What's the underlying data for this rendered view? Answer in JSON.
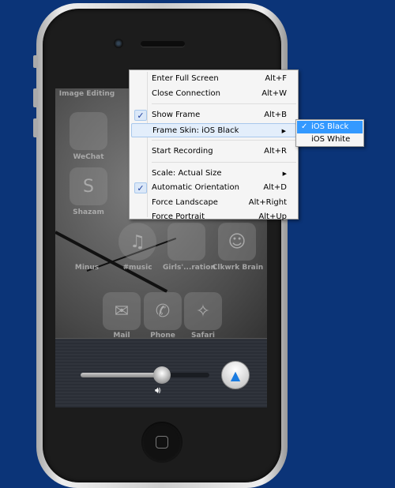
{
  "menu": {
    "items": [
      {
        "label": "Enter Full Screen",
        "shortcut": "Alt+F"
      },
      {
        "label": "Close Connection",
        "shortcut": "Alt+W"
      },
      {
        "label": "Show Frame",
        "shortcut": "Alt+B",
        "checked": true
      },
      {
        "label": "Frame Skin: iOS Black",
        "submenu": true,
        "highlighted": true
      },
      {
        "label": "Start Recording",
        "shortcut": "Alt+R"
      },
      {
        "label": "Scale: Actual Size",
        "submenu": true
      },
      {
        "label": "Automatic Orientation",
        "shortcut": "Alt+D",
        "checked": true
      },
      {
        "label": "Force Landscape",
        "shortcut": "Alt+Right"
      },
      {
        "label": "Force Portrait",
        "shortcut": "Alt+Up"
      }
    ]
  },
  "submenu": {
    "items": [
      {
        "label": "iOS Black",
        "checked": true
      },
      {
        "label": "iOS White"
      }
    ]
  },
  "apps": [
    "Image Editing",
    "WeChat",
    "Shazam",
    "Minus",
    "#music",
    "Girls'...ration",
    "Clkwrk Brain"
  ],
  "dock": [
    "Mail",
    "Phone",
    "Safari"
  ],
  "volume": {
    "level": 0.63
  },
  "colors": {
    "background": "#0b3478",
    "selection": "#3399ff",
    "airplay": "#1a7be0"
  }
}
